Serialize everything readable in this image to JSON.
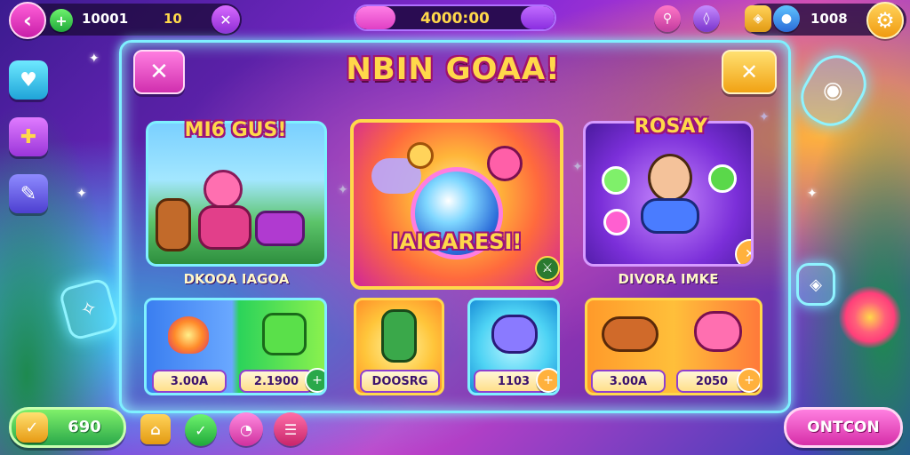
{
  "top_bar": {
    "stat_primary": "10001",
    "stat_secondary": "10",
    "timer": "4000:00",
    "timer_progress": 0.2,
    "stat_right": "1008"
  },
  "panel": {
    "title": "NBIN GOAA!",
    "cards": {
      "left": {
        "title": "MI6 GUS!",
        "caption": "DKOOA IAGOA"
      },
      "center": {
        "title": "IAIGARESI!"
      },
      "right": {
        "title": "ROSAY",
        "caption": "DIVORA IMKE"
      }
    },
    "items": [
      {
        "price": "3.00A"
      },
      {
        "price": "2.1900"
      },
      {
        "price": "DOOSRG"
      },
      {
        "price": "1103"
      },
      {
        "price": "3.00A"
      },
      {
        "price": "2050"
      }
    ]
  },
  "bottom_bar": {
    "coins": "690",
    "continue_label": "ONTCON"
  },
  "icons": {
    "back": "chevron-left-icon",
    "gem": "plus-gem-icon",
    "settings": "gear-icon",
    "close": "close-icon",
    "confirm": "close-icon"
  },
  "colors": {
    "accent_pink": "#d62ea8",
    "accent_yellow": "#ffd84a",
    "panel_border": "#7ff0ff",
    "bg_purple": "#8a2bd6"
  }
}
